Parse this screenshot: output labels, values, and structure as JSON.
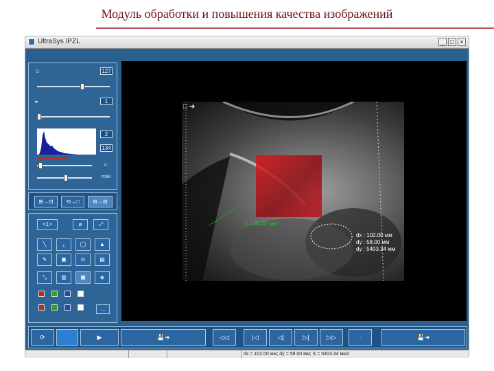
{
  "slide": {
    "title": "Модуль обработки и повышения качества изображений"
  },
  "window": {
    "title": "UltraSys IPZL",
    "buttons": {
      "minimize": "_",
      "maximize": "□",
      "close": "×"
    }
  },
  "adjust": {
    "brightness_value": "127",
    "contrast_value": "1",
    "hist_low": "2",
    "hist_high": "134",
    "hist_label": "n",
    "max_label": "max",
    "brightness_level": 0.62,
    "contrast_level": 0.03,
    "hist_low_level": 0.06,
    "hist_high_level": 0.52
  },
  "transfer_buttons": [
    "⊞→⊡",
    "⟲→□",
    "⊟→⊟"
  ],
  "tools": {
    "row1": [
      "<1>",
      "⌀",
      "⤢"
    ],
    "row2": [
      "╲",
      "⌞",
      "◯",
      "▲"
    ],
    "row3": [
      "✎",
      "▣",
      "⊙",
      "▤"
    ],
    "row4": [
      "⤡",
      "▥",
      "▦",
      "◈"
    ],
    "more": "...",
    "swatches": [
      "#cc2222",
      "#22aa22",
      "#2244cc",
      "#ffffff",
      "#cc2222",
      "#22aa22",
      "#2244cc",
      "#ffffff"
    ]
  },
  "measurement": {
    "length_label": "L = 84.02 мм",
    "dx": "dx : 102.00 мм",
    "dy": "dy : 58.00 мм",
    "area": "dy : 5403.34 мм"
  },
  "probe": {
    "marker": "□ ➔"
  },
  "bottom_bar": {
    "refresh": "⟳",
    "play": "▶",
    "save1": "💾➔",
    "nav": [
      "◁◁",
      "|◁",
      "◁|",
      "▷|",
      "▷▷",
      "·"
    ],
    "save2": "💾➔"
  },
  "statusbar": {
    "text": "dx = 102.00 мм; dy = 58.00 мм; S = 5403.34 мм2"
  },
  "colors": {
    "window_bg": "#2a5f8e",
    "overlay": "#c0101a",
    "measure": "#1fd41f"
  }
}
